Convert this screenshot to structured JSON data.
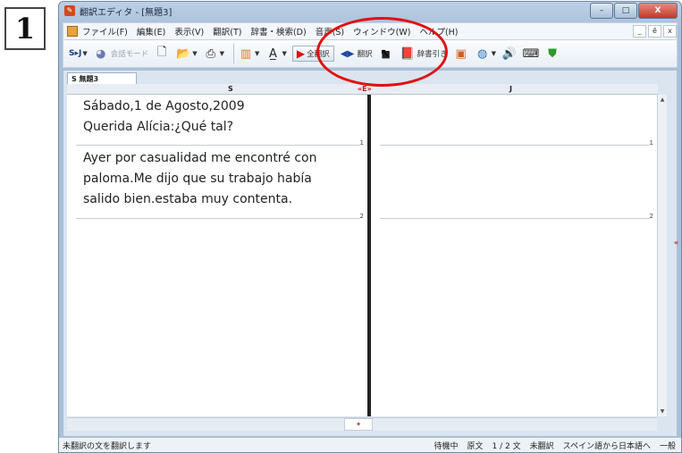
{
  "step_number": "1",
  "window": {
    "title": "翻訳エディタ - [無題3]",
    "controls": {
      "minimize": "–",
      "maximize": "□",
      "close": "X"
    }
  },
  "menubar": {
    "items": [
      "ファイル(F)",
      "編集(E)",
      "表示(V)",
      "翻訳(T)",
      "辞書・検索(D)",
      "音声(S)",
      "ウィンドウ(W)",
      "ヘルプ(H)"
    ],
    "mdi": {
      "minimize": "_",
      "restore": "ē",
      "close": "x"
    }
  },
  "toolbar": {
    "lang_pair": "S▸J",
    "mode_label": "会話モード",
    "translate_all": "全翻訳",
    "translate_one": "翻訳",
    "dict_lookup": "辞書引き"
  },
  "document": {
    "tab_label": "S 無題3",
    "left_header": "S",
    "right_header": "J",
    "splitter_mark": "«E»",
    "source_lines": [
      "Sábado,1 de Agosto,2009",
      "Querida Alícia:¿Qué tal?",
      "Ayer por casualidad me encontré con",
      "paloma.Me dijo que su trabajo había",
      "salido bien.estaba muy contenta."
    ],
    "segment_numbers": [
      "1",
      "2"
    ]
  },
  "statusbar": {
    "left": "未翻訳の文を翻訳します",
    "state": "待機中",
    "kind": "原文",
    "position": "1 / 2 文",
    "trans_state": "未翻訳",
    "direction": "スペイン語から日本語へ",
    "level": "一般"
  }
}
